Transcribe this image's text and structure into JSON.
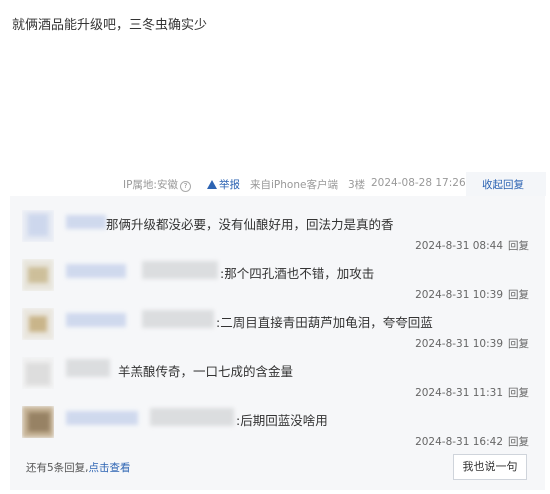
{
  "post": {
    "text": "就俩酒品能升级吧，三冬虫确实少"
  },
  "meta": {
    "ip": "IP属地:安徽",
    "report": "举报",
    "source": "来自iPhone客户端",
    "floor": "3楼",
    "time": "2024-08-28 17:26",
    "collapse": "收起回复"
  },
  "replies": [
    {
      "text": "那俩升级都没必要，没有仙酿好用，回法力是真的香",
      "time": "2024-8-31 08:44",
      "reply": "回复"
    },
    {
      "text": ":那个四孔酒也不错，加攻击",
      "time": "2024-8-31 10:39",
      "reply": "回复"
    },
    {
      "text": ":二周目直接青田葫芦加龟泪，夸夸回蓝",
      "time": "2024-8-31 10:39",
      "reply": "回复"
    },
    {
      "text": "羊羔酿传奇，一口七成的含金量",
      "time": "2024-8-31 11:31",
      "reply": "回复"
    },
    {
      "text": ":后期回蓝没啥用",
      "time": "2024-8-31 16:42",
      "reply": "回复"
    }
  ],
  "footer": {
    "more_prefix": "还有5条回复,",
    "more_link": "点击查看",
    "say_button": "我也说一句"
  },
  "colors": {
    "link": "#2d64b3",
    "panel": "#f6f7f9"
  }
}
